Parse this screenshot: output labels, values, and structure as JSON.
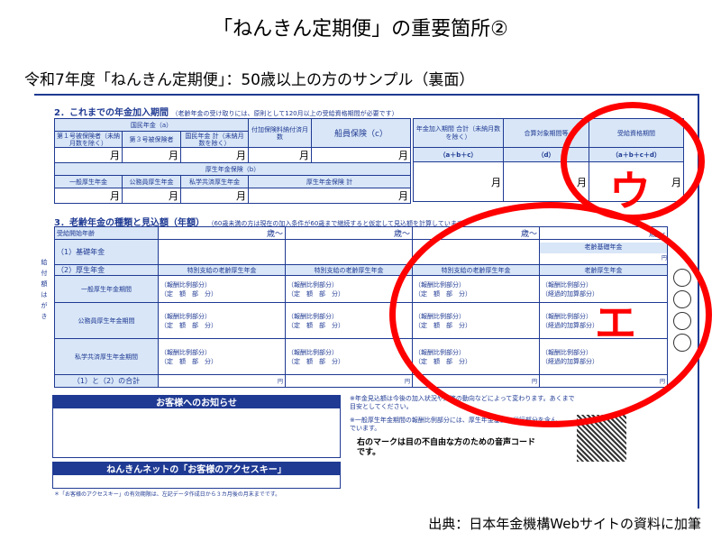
{
  "title": "「ねんきん定期便」の重要箇所②",
  "subtitle": "令和7年度「ねんきん定期便」：50歳以上の方のサンプル（裏面）",
  "source": "出典：日本年金機構Webサイトの資料に加筆",
  "section2": {
    "heading": "2．これまでの年金加入期間",
    "note": "（老齢年金の受け取りには、原則として120月以上の受給資格期間が必要です）",
    "kokumin": "国民年金（a）",
    "kokumin_cols": [
      "第１号被保険者（未納月数を除く）",
      "第３号被保険者",
      "国民年金 計（未納月数を除く）",
      "付加保険料納付済月数"
    ],
    "senin": "船員保険（c）",
    "total_label": "年金加入期間 合計（未納月数を除く）",
    "total_formula": "（a＋b＋c）",
    "gassan": "合算対象期間等",
    "gassan_d": "（d）",
    "jukyu": "受給資格期間",
    "jukyu_formula": "（a＋b＋c＋d）",
    "kosei": "厚生年金保険（b）",
    "kosei_cols": [
      "一般厚生年金",
      "公務員厚生年金",
      "私学共済厚生年金",
      "厚生年金保険 計"
    ],
    "month": "月"
  },
  "section3": {
    "heading": "3．老齢年金の種類と見込額（年額）",
    "note": "（60歳未満の方は現在の加入条件が60歳まで継続すると仮定して見込額を計算しています）",
    "start_age": "受給開始年齢",
    "age": "歳〜",
    "kiso": "（1）基礎年金",
    "rourei_kiso": "老齢基礎年金",
    "kosei": "（2）厚生年金",
    "tokubetsu": "特別支給の老齢厚生年金",
    "rourei_kosei": "老齢厚生年金",
    "rows": [
      "一般厚生年金期間",
      "公務員厚生年金期間",
      "私学共済厚生年金期間"
    ],
    "hoshu": "（報酬比例部分）",
    "teigaku": "（定　額　部　分）",
    "keika": "（経過的加算部分）",
    "yen": "円",
    "total": "（1）と（2）の合計",
    "vertical": "給付額　は　が　き"
  },
  "notice": {
    "header": "お客様へのお知らせ",
    "access_header": "ねんきんネットの「お客様のアクセスキー」",
    "access_note": "＊「お客様のアクセスキー」の有効期限は、左記データ作成日から３カ月後の月末までです。",
    "note1": "※年金見込額は今後の加入状況や経済の動向などによって変わります。あくまで目安としてください。",
    "note2": "※一般厚生年金期間の報酬比例部分には、厚生年金基金の代行部分を含んでいます。",
    "bold_note": "右のマークは目の不自由な方のための音声コードです。"
  },
  "annotations": {
    "u": "ウ",
    "e": "エ",
    "color": "#ff0000"
  }
}
